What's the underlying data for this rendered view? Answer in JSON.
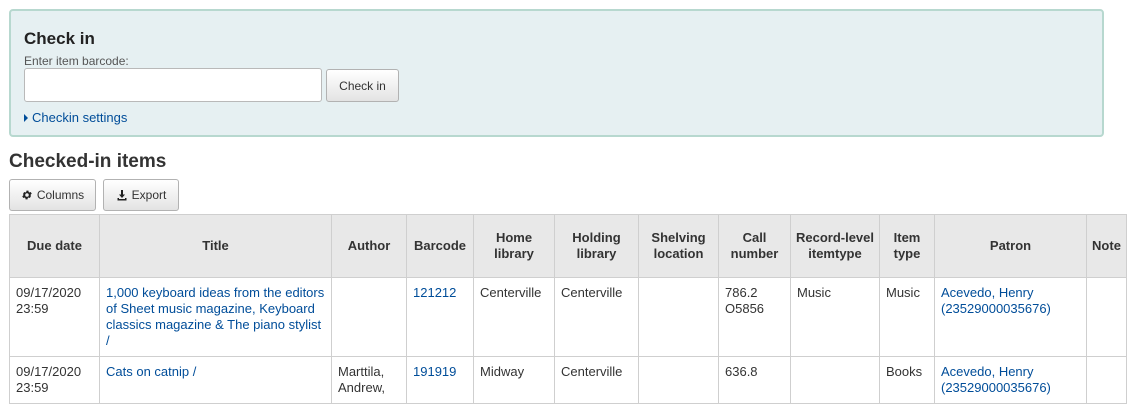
{
  "checkin": {
    "title": "Check in",
    "barcode_label": "Enter item barcode:",
    "barcode_value": "",
    "button_label": "Check in",
    "settings_link": "Checkin settings"
  },
  "checked_in": {
    "title": "Checked-in items",
    "columns_button": "Columns",
    "export_button": "Export",
    "headers": [
      "Due date",
      "Title",
      "Author",
      "Barcode",
      "Home library",
      "Holding library",
      "Shelving location",
      "Call number",
      "Record-level itemtype",
      "Item type",
      "Patron",
      "Note"
    ],
    "rows": [
      {
        "due_date": "09/17/2020 23:59",
        "title": "1,000 keyboard ideas from the editors of Sheet music magazine, Keyboard classics magazine & The piano stylist /",
        "author": "",
        "barcode": "121212",
        "home_library": "Centerville",
        "holding_library": "Centerville",
        "shelving_location": "",
        "call_number": "786.2 O5856",
        "record_itemtype": "Music",
        "item_type": "Music",
        "patron": "Acevedo, Henry (23529000035676)",
        "note": ""
      },
      {
        "due_date": "09/17/2020 23:59",
        "title": "Cats on catnip /",
        "author": "Marttila, Andrew,",
        "barcode": "191919",
        "home_library": "Midway",
        "holding_library": "Centerville",
        "shelving_location": "",
        "call_number": "636.8",
        "record_itemtype": "",
        "item_type": "Books",
        "patron": "Acevedo, Henry (23529000035676)",
        "note": ""
      }
    ]
  }
}
